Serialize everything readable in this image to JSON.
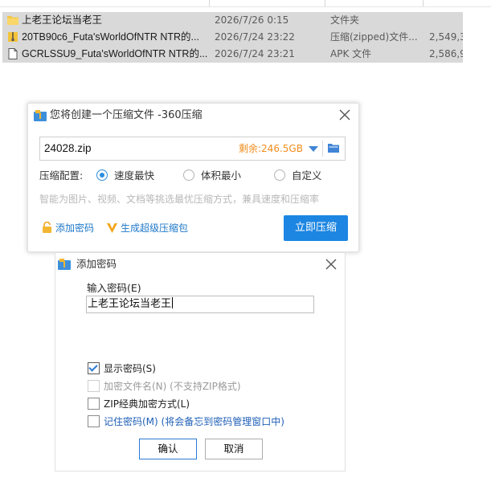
{
  "file_list": {
    "rows": [
      {
        "icon": "folder-icon",
        "name": "上老王论坛当老王",
        "date": "2026/7/26 0:15",
        "type": "文件夹",
        "size": ""
      },
      {
        "icon": "zip-file-icon",
        "name": "20TB90c6_Futa'sWorldOfNTR NTR的...",
        "date": "2026/7/24 23:22",
        "type": "压缩(zipped)文件...",
        "size": "2,549,3"
      },
      {
        "icon": "file-icon",
        "name": "GCRLSSU9_Futa'sWorldOfNTR NTR的...",
        "date": "2026/7/24 23:21",
        "type": "APK 文件",
        "size": "2,586,9"
      }
    ]
  },
  "compress_dialog": {
    "title": "您将创建一个压缩文件 -360压缩",
    "filename": "24028.zip",
    "free_space": "剩余:246.5GB",
    "config_label": "压缩配置:",
    "options": [
      {
        "label": "速度最快",
        "selected": true
      },
      {
        "label": "体积最小",
        "selected": false
      },
      {
        "label": "自定义",
        "selected": false
      }
    ],
    "hint": "智能为图片、视频、文档等挑选最优压缩方式，兼具速度和压缩率",
    "add_password": "添加密码",
    "super_package": "生成超级压缩包",
    "compress_button": "立即压缩"
  },
  "password_dialog": {
    "title": "添加密码",
    "input_label": "输入密码(E)",
    "password_value": "上老王论坛当老王",
    "checks": [
      {
        "label": "显示密码(S)",
        "checked": true,
        "disabled": false
      },
      {
        "label": "加密文件名(N) (不支持ZIP格式)",
        "checked": false,
        "disabled": true
      },
      {
        "label": "ZIP经典加密方式(L)",
        "checked": false,
        "disabled": false
      },
      {
        "label": "记住密码(M) (将会备忘到密码管理窗口中)",
        "checked": false,
        "disabled": false
      }
    ],
    "ok": "确认",
    "cancel": "取消"
  },
  "colors": {
    "accent": "#1c86e2",
    "free_space": "#f08c1c",
    "link": "#1f78c9",
    "row_selected": "#d9d9d9"
  }
}
